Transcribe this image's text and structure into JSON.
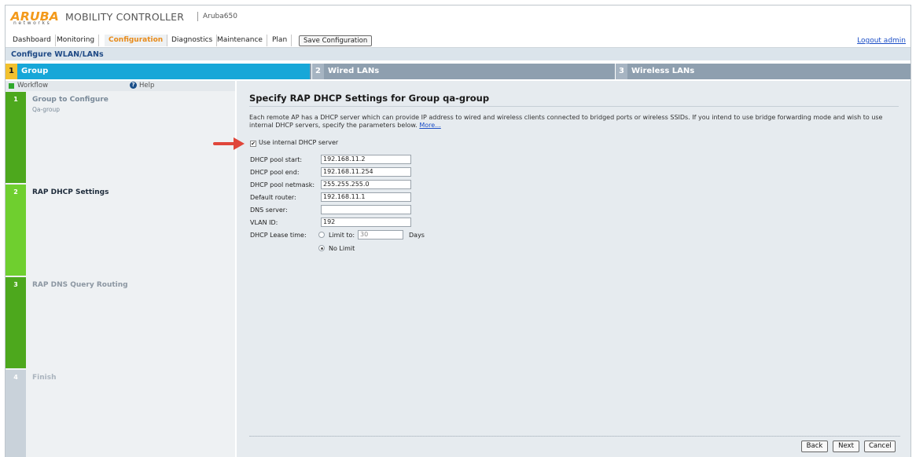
{
  "brand": {
    "logo_text": "ARUBA",
    "logo_sub": "networks",
    "product": "MOBILITY CONTROLLER",
    "device": "Aruba650"
  },
  "nav": {
    "tabs": [
      "Dashboard",
      "Monitoring",
      "Configuration",
      "Diagnostics",
      "Maintenance",
      "Plan"
    ],
    "active": "Configuration",
    "save_label": "Save Configuration",
    "logout": "Logout admin"
  },
  "page_title": "Configure WLAN/LANs",
  "wizard": {
    "steps": [
      {
        "num": "1",
        "label": "Group"
      },
      {
        "num": "2",
        "label": "Wired LANs"
      },
      {
        "num": "3",
        "label": "Wireless LANs"
      }
    ]
  },
  "workflow": {
    "header": "Workflow",
    "help": "Help",
    "steps": [
      {
        "num": "1",
        "title": "Group to Configure",
        "sub": "Qa-group"
      },
      {
        "num": "2",
        "title": "RAP DHCP Settings",
        "sub": ""
      },
      {
        "num": "3",
        "title": "RAP DNS Query Routing",
        "sub": ""
      },
      {
        "num": "4",
        "title": "Finish",
        "sub": ""
      }
    ]
  },
  "main": {
    "title": "Specify RAP DHCP Settings for Group qa-group",
    "description": "Each remote AP has a DHCP server which can provide IP address to wired and wireless clients connected to bridged ports or wireless SSIDs. If you intend to use bridge forwarding mode and wish to use internal DHCP servers, specify the parameters below.",
    "more_link": "More...",
    "use_internal_label": "Use internal DHCP server",
    "use_internal_checked": true,
    "fields": {
      "pool_start": {
        "label": "DHCP pool start:",
        "value": "192.168.11.2"
      },
      "pool_end": {
        "label": "DHCP pool end:",
        "value": "192.168.11.254"
      },
      "netmask": {
        "label": "DHCP pool netmask:",
        "value": "255.255.255.0"
      },
      "router": {
        "label": "Default router:",
        "value": "192.168.11.1"
      },
      "dns": {
        "label": "DNS server:",
        "value": ""
      },
      "vlan": {
        "label": "VLAN ID:",
        "value": "192"
      }
    },
    "lease": {
      "label": "DHCP Lease time:",
      "limit_label": "Limit to:",
      "limit_value": "30",
      "unit": "Days",
      "no_limit_label": "No Limit",
      "selected": "No Limit"
    },
    "buttons": {
      "back": "Back",
      "next": "Next",
      "cancel": "Cancel"
    }
  },
  "colors": {
    "accent_orange": "#e88b1a",
    "wizard_active": "#17a7d8",
    "wizard_inactive": "#8e9faf",
    "workflow_green": "#4da81d",
    "workflow_active_green": "#6fcf2f",
    "link_blue": "#1b4ec6",
    "annotation_arrow": "#e0463a"
  }
}
